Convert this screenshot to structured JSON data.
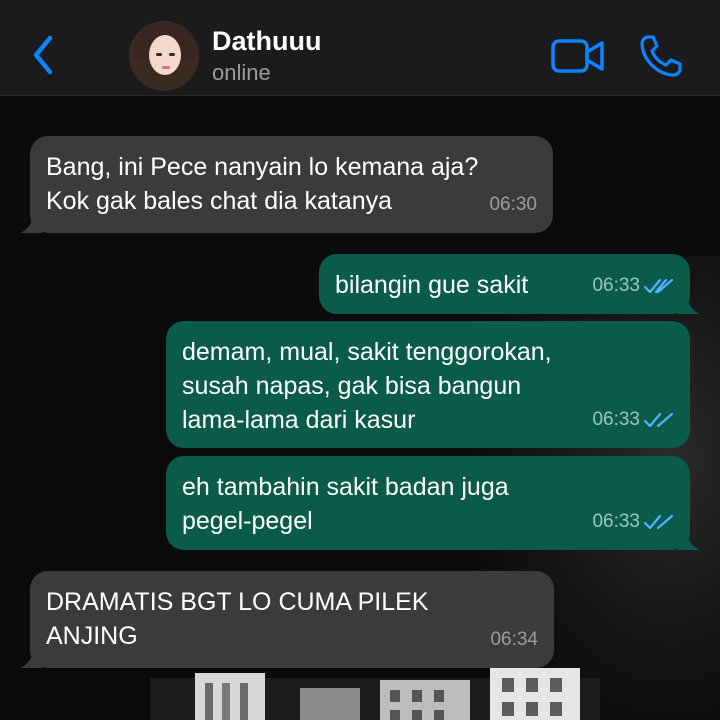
{
  "header": {
    "contact_name": "Dathuuu",
    "status": "online",
    "back_icon": "chevron-left-icon",
    "video_icon": "video-camera-icon",
    "call_icon": "phone-icon",
    "accent_color": "#0a84ff"
  },
  "messages": [
    {
      "direction": "incoming",
      "text": "Bang, ini Pece nanyain lo kemana aja?\nKok gak bales chat dia katanya",
      "time": "06:30"
    },
    {
      "direction": "outgoing",
      "text": "bilangin gue sakit",
      "time": "06:33",
      "status": "read"
    },
    {
      "direction": "outgoing",
      "text": "demam, mual, sakit tenggorokan,\nsusah napas, gak bisa bangun\nlama-lama dari kasur",
      "time": "06:33",
      "status": "read"
    },
    {
      "direction": "outgoing",
      "text": "eh tambahin sakit badan juga\npegel-pegel",
      "time": "06:33",
      "status": "read"
    },
    {
      "direction": "incoming",
      "text": "DRAMATIS BGT LO CUMA PILEK\nANJING",
      "time": "06:34"
    }
  ],
  "colors": {
    "incoming_bubble": "#3b3b3d",
    "outgoing_bubble": "#0a5b4a",
    "read_ticks": "#4fb3ff"
  }
}
